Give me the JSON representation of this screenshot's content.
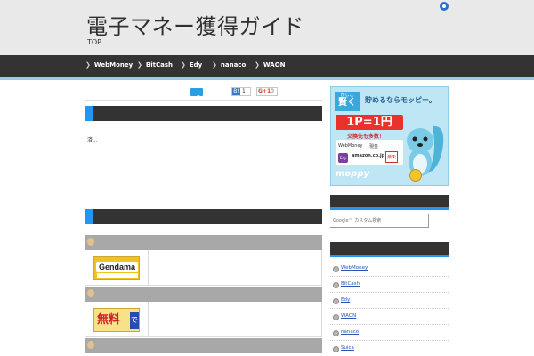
{
  "header": {
    "site_title": "電子マネー獲得ガイド",
    "breadcrumb": "TOP",
    "rss_icon": "rss-icon"
  },
  "nav": {
    "items": [
      {
        "label": "WebMoney"
      },
      {
        "label": "BitCash"
      },
      {
        "label": "Edy"
      },
      {
        "label": "nanaco"
      },
      {
        "label": "WAON"
      }
    ]
  },
  "share": {
    "hatena_count": "1",
    "gplus_label": "G+1",
    "gplus_count": "0"
  },
  "main": {
    "section1_title": "",
    "excerpt": "済...",
    "section2_title": ""
  },
  "ad": {
    "tag_small": "かしこ",
    "tag_big": "賢く",
    "headline": "貯めるならモッピー。",
    "rate": "1P=1円",
    "sub": "交換先も多数！",
    "logo_webmoney": "WebMoney",
    "logo_genkin": "現金",
    "logo_amazon": "amazon.co.jp",
    "logo_edy": "Edy",
    "logo_rakuten": "楽天",
    "brand": "moppy"
  },
  "sidebar": {
    "search_placeholder": "Google™ カスタム検索",
    "links": [
      {
        "label": "WebMoney"
      },
      {
        "label": "BitCash"
      },
      {
        "label": "Edy"
      },
      {
        "label": "WAON"
      },
      {
        "label": "nanaco"
      },
      {
        "label": "Suica"
      }
    ]
  },
  "list": {
    "banners": [
      {
        "text": "Gendama"
      },
      {
        "text": "無料",
        "tail": "で"
      }
    ]
  },
  "colors": {
    "nav_bg": "#333333",
    "accent": "#2196f3",
    "header_bg": "#e9e9e9",
    "link": "#2b55b3"
  }
}
